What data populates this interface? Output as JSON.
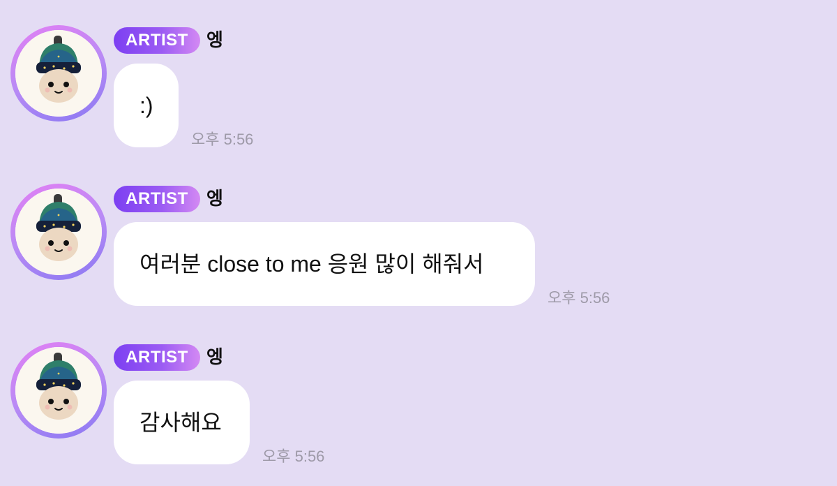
{
  "colors": {
    "background": "#e4dcf4",
    "bubble": "#ffffff",
    "badge_start": "#7c3ff2",
    "badge_end": "#d389f3",
    "timestamp": "#9e9aa8"
  },
  "messages": [
    {
      "badge": "ARTIST",
      "sender": "엥",
      "text": ":)",
      "time": "오후 5:56",
      "avatar_icon": "plush-doll-avatar-icon"
    },
    {
      "badge": "ARTIST",
      "sender": "엥",
      "text": "여러분 close to me 응원 많이 해줘서",
      "time": "오후 5:56",
      "avatar_icon": "plush-doll-avatar-icon"
    },
    {
      "badge": "ARTIST",
      "sender": "엥",
      "text": "감사해요",
      "time": "오후 5:56",
      "avatar_icon": "plush-doll-avatar-icon"
    }
  ]
}
